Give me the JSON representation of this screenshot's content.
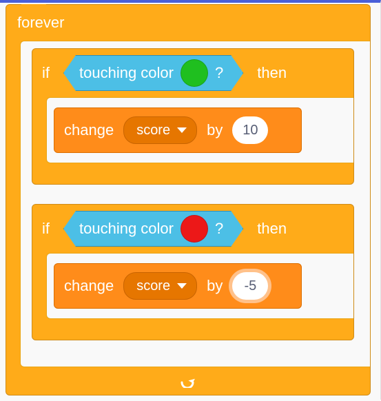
{
  "forever": {
    "label": "forever"
  },
  "if1": {
    "if_label": "if",
    "then_label": "then",
    "condition": {
      "prefix": "touching color",
      "suffix": "?",
      "color": "#1fbf1f"
    },
    "action": {
      "change_label": "change",
      "var_name": "score",
      "by_label": "by",
      "value": "10"
    }
  },
  "if2": {
    "if_label": "if",
    "then_label": "then",
    "condition": {
      "prefix": "touching color",
      "suffix": "?",
      "color": "#ec1818"
    },
    "action": {
      "change_label": "change",
      "var_name": "score",
      "by_label": "by",
      "value": "-5"
    }
  }
}
